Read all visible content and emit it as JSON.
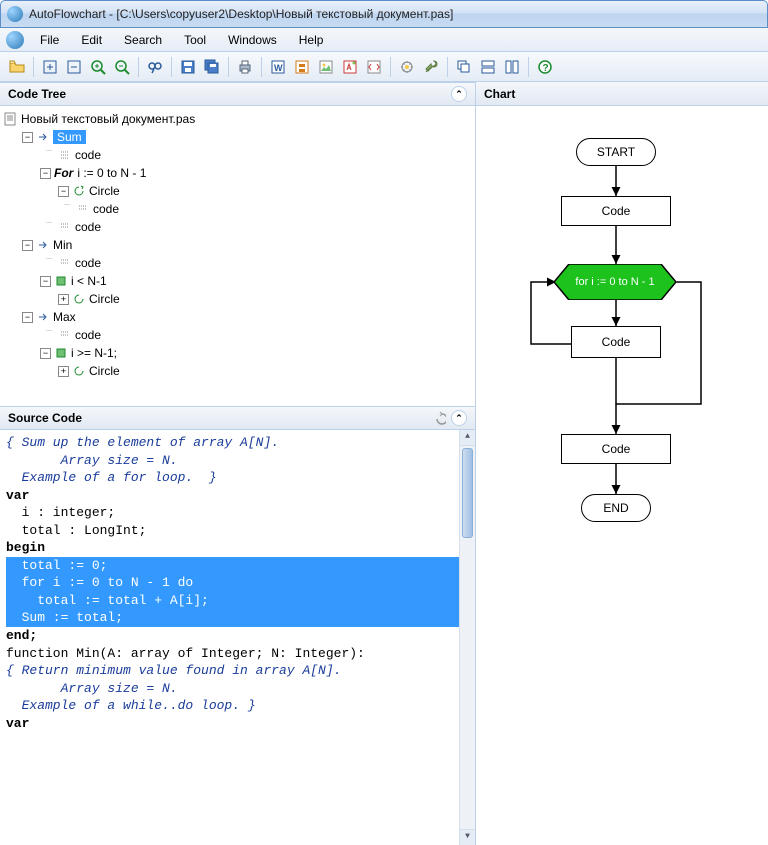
{
  "title": "AutoFlowchart - [C:\\Users\\copyuser2\\Desktop\\Новый текстовый документ.pas]",
  "menu": {
    "file": "File",
    "edit": "Edit",
    "search": "Search",
    "tool": "Tool",
    "windows": "Windows",
    "help": "Help"
  },
  "panels": {
    "code_tree": "Code Tree",
    "source_code": "Source Code",
    "chart": "Chart"
  },
  "tree": {
    "root": "Новый текстовый документ.pas",
    "sum": "Sum",
    "code": "code",
    "for": "For",
    "for_cond": "i := 0 to N - 1",
    "circle": "Circle",
    "min": "Min",
    "lt": "i < N-1",
    "max": "Max",
    "ge": "i >= N-1;"
  },
  "flow": {
    "start": "START",
    "code": "Code",
    "loop": "for i := 0 to N - 1",
    "end": "END"
  },
  "src": {
    "l1": "{ Sum up the element of array A[N].",
    "l2": "       Array size = N.",
    "l3": "  Example of a for loop.  }",
    "l4": "var",
    "l5": "  i : integer;",
    "l6": "  total : LongInt;",
    "l7": "begin",
    "l8": "  total := 0;",
    "l9": "  for i := 0 to N - 1 do",
    "l10": "    total := total + A[i];",
    "l11": "",
    "l12": "  Sum := total;",
    "l13": "end;",
    "l14": "",
    "l15": "function Min(A: array of Integer; N: Integer):",
    "l16": "{ Return minimum value found in array A[N].",
    "l17": "       Array size = N.",
    "l18": "  Example of a while..do loop. }",
    "l19": "var"
  }
}
